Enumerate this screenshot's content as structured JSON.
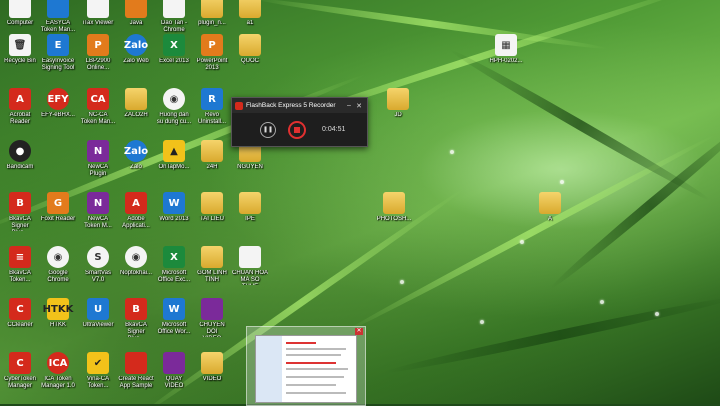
{
  "desktop_icons": [
    {
      "label": "Computer",
      "glyph": "",
      "style": "g-white"
    },
    {
      "label": "EASYCA\nToken Man...",
      "glyph": "",
      "style": "g-blue"
    },
    {
      "label": "iTax Viewer",
      "glyph": "",
      "style": "g-white"
    },
    {
      "label": "Java",
      "glyph": "",
      "style": "g-orange"
    },
    {
      "label": "Dao Tan -\nChrome",
      "glyph": "",
      "style": "g-white"
    },
    {
      "label": "plugin_n...",
      "glyph": "",
      "style": "g-folder"
    },
    {
      "label": "a1",
      "glyph": "",
      "style": "g-folder"
    },
    {
      "label": "Recycle Bin",
      "glyph": "🗑",
      "style": "g-white"
    },
    {
      "label": "EasyInvoice\nSigning Tool",
      "glyph": "E",
      "style": "g-blue"
    },
    {
      "label": "LBP2900\nOnline...",
      "glyph": "P",
      "style": "g-orange"
    },
    {
      "label": "Zalo Web",
      "glyph": "Zalo",
      "style": "g-blue g-round"
    },
    {
      "label": "Excel 2013",
      "glyph": "X",
      "style": "g-green"
    },
    {
      "label": "PowerPoint\n2013",
      "glyph": "P",
      "style": "g-orange"
    },
    {
      "label": "QUOC",
      "glyph": "",
      "style": "g-folder"
    },
    {
      "label": "HPH-0202...",
      "glyph": "▦",
      "style": "g-white"
    },
    {
      "label": "Acrobat\nReader",
      "glyph": "A",
      "style": "g-red"
    },
    {
      "label": "EFY-eBHX...",
      "glyph": "EFY",
      "style": "g-red g-round"
    },
    {
      "label": "NC-CA\nToken Man...",
      "glyph": "CA",
      "style": "g-red"
    },
    {
      "label": "ZALO2H",
      "glyph": "",
      "style": "g-folder"
    },
    {
      "label": "Huong dan\nsu dung cu...",
      "glyph": "◉",
      "style": "g-white g-round"
    },
    {
      "label": "Revo\nUninstall...",
      "glyph": "R",
      "style": "g-blue"
    },
    {
      "label": "JD",
      "glyph": "",
      "style": "g-folder"
    },
    {
      "label": "Bandicam",
      "glyph": "●",
      "style": "g-dark g-round"
    },
    {
      "label": "NewCA\nPlugin",
      "glyph": "N",
      "style": "g-purple"
    },
    {
      "label": "Zalo",
      "glyph": "Zalo",
      "style": "g-blue g-round"
    },
    {
      "label": "OnTapMo...",
      "glyph": "▲",
      "style": "g-yellow"
    },
    {
      "label": "24H",
      "glyph": "",
      "style": "g-folder"
    },
    {
      "label": "NGUYEN",
      "glyph": "",
      "style": "g-folder"
    },
    {
      "label": "BkavCA\nSigner Plug...",
      "glyph": "B",
      "style": "g-red"
    },
    {
      "label": "Foxit Reader",
      "glyph": "G",
      "style": "g-orange"
    },
    {
      "label": "NewCA\nToken M...",
      "glyph": "N",
      "style": "g-purple"
    },
    {
      "label": "Adobe\nApplicati...",
      "glyph": "A",
      "style": "g-red"
    },
    {
      "label": "Word 2013",
      "glyph": "W",
      "style": "g-blue"
    },
    {
      "label": "TAI LIEU",
      "glyph": "",
      "style": "g-folder"
    },
    {
      "label": "IPE",
      "glyph": "",
      "style": "g-folder"
    },
    {
      "label": "PHOTOSH...",
      "glyph": "",
      "style": "g-folder"
    },
    {
      "label": "A",
      "glyph": "",
      "style": "g-folder"
    },
    {
      "label": "BkavCA\nToken...",
      "glyph": "≡",
      "style": "g-red"
    },
    {
      "label": "Google\nChrome",
      "glyph": "◉",
      "style": "g-white g-round"
    },
    {
      "label": "SmartVas\nV7.0",
      "glyph": "S",
      "style": "g-white g-round"
    },
    {
      "label": "Noptokhai...",
      "glyph": "◉",
      "style": "g-white g-round"
    },
    {
      "label": "Microsoft\nOffice Exc...",
      "glyph": "X",
      "style": "g-green"
    },
    {
      "label": "GOM LINH\nTINH",
      "glyph": "",
      "style": "g-folder"
    },
    {
      "label": "CHUAN HOA\nMA SO THUE",
      "glyph": "",
      "style": "g-white"
    },
    {
      "label": "CCleaner",
      "glyph": "C",
      "style": "g-red"
    },
    {
      "label": "HTKK",
      "glyph": "HTKK",
      "style": "g-yellow"
    },
    {
      "label": "UltraViewer",
      "glyph": "U",
      "style": "g-blue"
    },
    {
      "label": "BkavCA\nSigner Plug...",
      "glyph": "B",
      "style": "g-red"
    },
    {
      "label": "Microsoft\nOffice Wor...",
      "glyph": "W",
      "style": "g-blue"
    },
    {
      "label": "CHUYEN DOI\nVIDEO",
      "glyph": "",
      "style": "g-purple"
    },
    {
      "label": "CyberToken\nManager",
      "glyph": "C",
      "style": "g-red"
    },
    {
      "label": "ICA Token\nManager 1.0",
      "glyph": "ICA",
      "style": "g-red g-round"
    },
    {
      "label": "Vina-CA\nToken...",
      "glyph": "✔",
      "style": "g-yellow"
    },
    {
      "label": "Create React\nApp Sample",
      "glyph": "",
      "style": "g-red"
    },
    {
      "label": "QUAY VIDEO",
      "glyph": "",
      "style": "g-purple"
    },
    {
      "label": "VIDEO",
      "glyph": "",
      "style": "g-folder"
    }
  ],
  "recorder": {
    "title": "FlashBack Express 5 Recorder",
    "minimize": "–",
    "close": "✕",
    "pause": "❚❚",
    "timer": "0:04:51"
  },
  "thumbnail": {
    "close": "✕"
  }
}
